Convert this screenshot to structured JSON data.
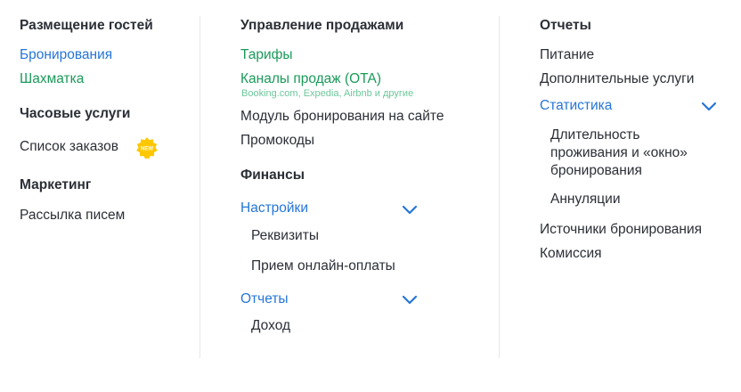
{
  "col1": {
    "h1": "Размещение гостей",
    "bookings": "Бронирования",
    "chess": "Шахматка",
    "h2": "Часовые услуги",
    "orders": "Список заказов",
    "new_badge": "NEW",
    "h3": "Маркетинг",
    "mailing": "Рассылка писем"
  },
  "col2": {
    "h1": "Управление продажами",
    "tariffs": "Тарифы",
    "ota": "Каналы продаж (OTA)",
    "ota_sub": "Booking.com, Expedia, Airbnb и другие",
    "module": "Модуль бронирования на сайте",
    "promo": "Промокоды",
    "h2": "Финансы",
    "settings": "Настройки",
    "requisites": "Реквизиты",
    "online_pay": "Прием онлайн-оплаты",
    "reports": "Отчеты",
    "income": "Доход"
  },
  "col3": {
    "h1": "Отчеты",
    "food": "Питание",
    "extra": "Дополнительные услуги",
    "stats": "Статистика",
    "duration": "Длительность проживания и «окно» бронирования",
    "cancel": "Аннуляции",
    "sources": "Источники бронирования",
    "commission": "Комиссия"
  },
  "icons": {
    "chevron": "chevron-down-icon",
    "badge": "new-badge-icon"
  },
  "colors": {
    "link_blue": "#2575d8",
    "link_green": "#1a9a5a",
    "badge_yellow": "#ffc700"
  }
}
